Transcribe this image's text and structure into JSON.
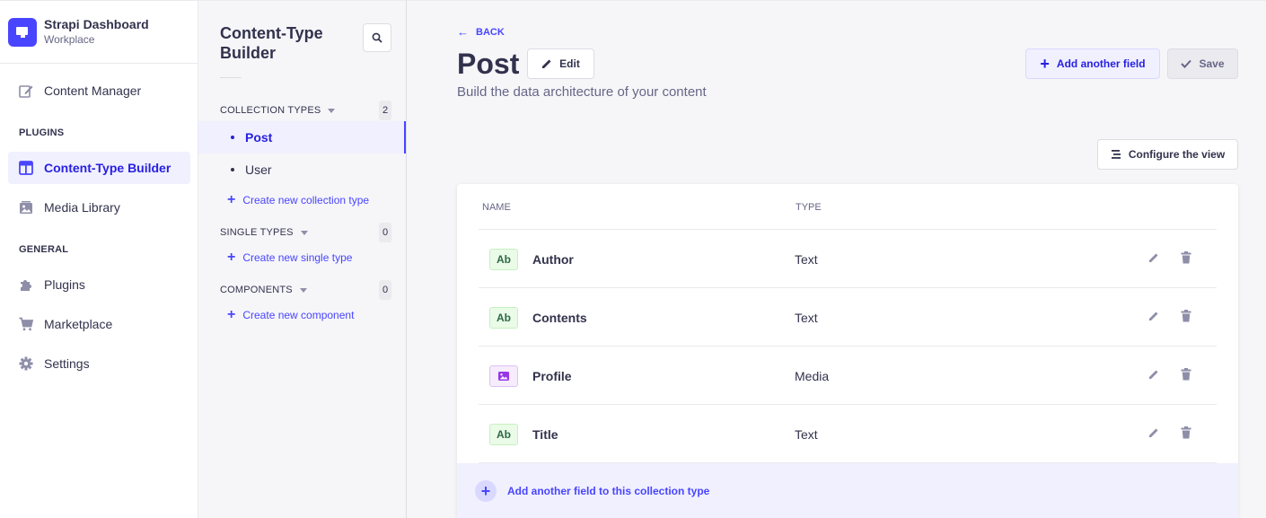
{
  "brand": {
    "title": "Strapi Dashboard",
    "subtitle": "Workplace"
  },
  "mainnav": {
    "content_manager": "Content Manager",
    "plugins_section": "PLUGINS",
    "content_type_builder": "Content-Type Builder",
    "media_library": "Media Library",
    "general_section": "GENERAL",
    "plugins": "Plugins",
    "marketplace": "Marketplace",
    "settings": "Settings"
  },
  "subnav": {
    "title": "Content-Type Builder",
    "collection_types": {
      "label": "COLLECTION TYPES",
      "count": "2",
      "items": [
        "Post",
        "User"
      ],
      "create": "Create new collection type"
    },
    "single_types": {
      "label": "SINGLE TYPES",
      "count": "0",
      "create": "Create new single type"
    },
    "components": {
      "label": "COMPONENTS",
      "count": "0",
      "create": "Create new component"
    }
  },
  "main": {
    "back": "BACK",
    "title": "Post",
    "edit": "Edit",
    "subtitle": "Build the data architecture of your content",
    "add_field": "Add another field",
    "save": "Save",
    "configure_view": "Configure the view",
    "columns": {
      "name": "NAME",
      "type": "TYPE"
    },
    "fields": [
      {
        "icon": "Ab",
        "name": "Author",
        "type": "Text"
      },
      {
        "icon": "Ab",
        "name": "Contents",
        "type": "Text"
      },
      {
        "icon": "media-icon",
        "name": "Profile",
        "type": "Media"
      },
      {
        "icon": "Ab",
        "name": "Title",
        "type": "Text"
      }
    ],
    "add_field_row": "Add another field to this collection type"
  },
  "colors": {
    "primary": "#4945ff",
    "primary_light": "#f0f0ff",
    "text": "#32324d",
    "muted": "#666687"
  }
}
